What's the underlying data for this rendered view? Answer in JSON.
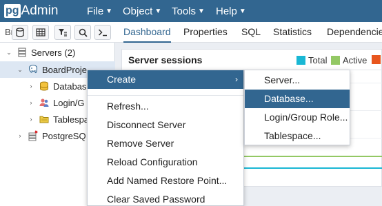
{
  "app": {
    "logo_pg": "pg",
    "logo_admin": "Admin",
    "menu": [
      {
        "label": "File",
        "icon": "caret-down-icon"
      },
      {
        "label": "Object",
        "icon": "caret-down-icon"
      },
      {
        "label": "Tools",
        "icon": "caret-down-icon"
      },
      {
        "label": "Help",
        "icon": "caret-down-icon"
      }
    ]
  },
  "browser": {
    "label": "Br",
    "toolbar": [
      {
        "name": "query-tool-icon"
      },
      {
        "name": "view-data-icon"
      },
      {
        "name": "filtered-rows-icon"
      },
      {
        "name": "search-objects-icon"
      },
      {
        "name": "psql-tool-icon"
      }
    ],
    "tree": [
      {
        "label": "Servers (2)",
        "icon": "servers-icon",
        "expanded": true
      },
      {
        "label": "BoardProje",
        "icon": "server-icon",
        "expanded": true,
        "selected": true
      },
      {
        "label": "Databas",
        "icon": "databases-icon",
        "expanded": false
      },
      {
        "label": "Login/G",
        "icon": "login-roles-icon",
        "expanded": false
      },
      {
        "label": "Tablespa",
        "icon": "tablespaces-icon",
        "expanded": false
      },
      {
        "label": "PostgreSQ",
        "icon": "server-disconnected-icon",
        "expanded": false
      }
    ]
  },
  "tabs": [
    "Dashboard",
    "Properties",
    "SQL",
    "Statistics",
    "Dependencies"
  ],
  "active_tab": "Dashboard",
  "dashboard": {
    "card_title": "Server sessions",
    "legend": [
      {
        "label": "Total",
        "color": "#19b7d4"
      },
      {
        "label": "Active",
        "color": "#93c864"
      },
      {
        "label": "",
        "color": "#e8561e"
      }
    ]
  },
  "context_menu": {
    "items": [
      "Create",
      "Refresh...",
      "Disconnect Server",
      "Remove Server",
      "Reload Configuration",
      "Add Named Restore Point...",
      "Clear Saved Password"
    ],
    "highlighted": "Create",
    "submenu_arrow": "›"
  },
  "submenu": {
    "items": [
      "Server...",
      "Database...",
      "Login/Group Role...",
      "Tablespace..."
    ],
    "highlighted": "Database..."
  },
  "colors": {
    "brand": "#326690",
    "selection": "#dde7f3"
  }
}
